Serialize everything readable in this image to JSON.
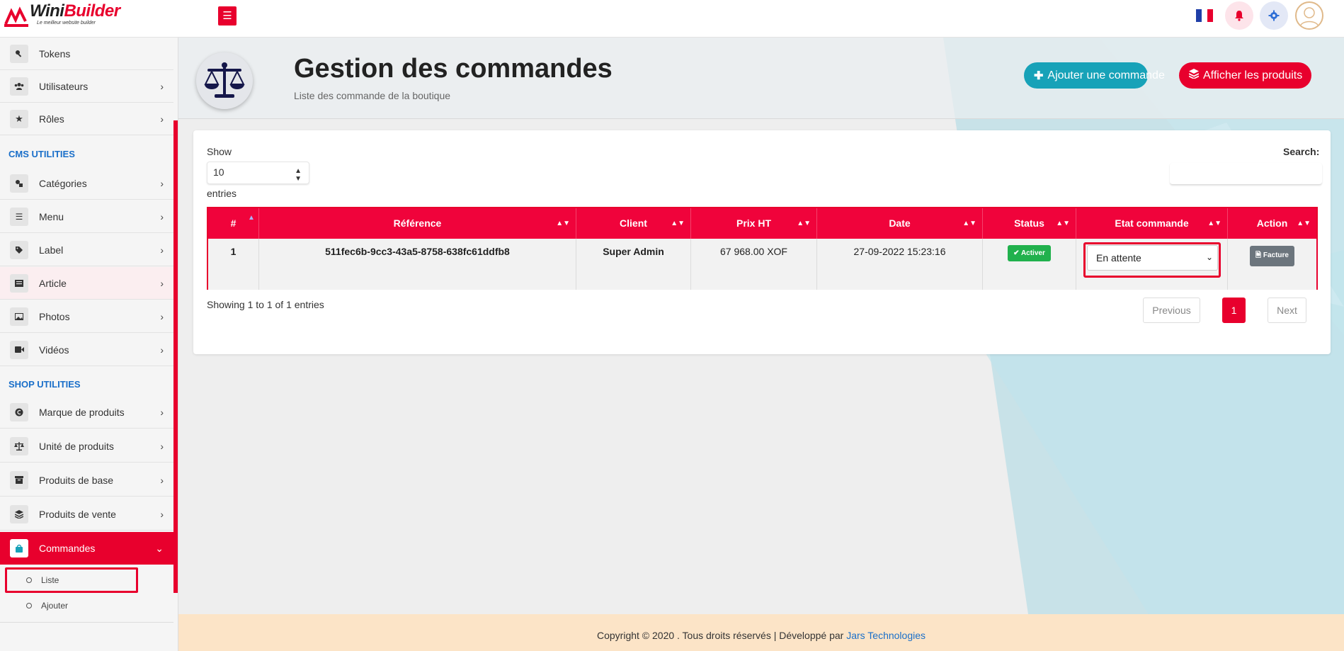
{
  "brand": {
    "name_part1": "Wini",
    "name_part2": "Builder",
    "tagline": "Le meilleur website builder"
  },
  "topbar": {
    "menu_toggle_icon": "hamburger-icon",
    "flag": "fr-flag",
    "notification_icon": "bell-icon",
    "settings_icon": "gear-icon",
    "avatar_icon": "user-avatar-icon"
  },
  "sidebar": {
    "items": [
      {
        "label": "Tokens",
        "icon": "key-icon"
      },
      {
        "label": "Utilisateurs",
        "icon": "users-icon"
      },
      {
        "label": "Rôles",
        "icon": "star-icon"
      }
    ],
    "cms_title": "CMS UTILITIES",
    "cms_items": [
      {
        "label": "Catégories",
        "icon": "shapes-icon"
      },
      {
        "label": "Menu",
        "icon": "list-icon"
      },
      {
        "label": "Label",
        "icon": "tags-icon"
      },
      {
        "label": "Article",
        "icon": "newspaper-icon"
      },
      {
        "label": "Photos",
        "icon": "image-icon"
      },
      {
        "label": "Vidéos",
        "icon": "video-icon"
      }
    ],
    "shop_title": "SHOP UTILITIES",
    "shop_items": [
      {
        "label": "Marque de produits",
        "icon": "copyright-icon"
      },
      {
        "label": "Unité de produits",
        "icon": "balance-icon"
      },
      {
        "label": "Produits de base",
        "icon": "archive-icon"
      },
      {
        "label": "Produits de vente",
        "icon": "layers-icon"
      },
      {
        "label": "Commandes",
        "icon": "shopping-bag-icon"
      }
    ],
    "sub_items": [
      {
        "label": "Liste"
      },
      {
        "label": "Ajouter"
      }
    ]
  },
  "header": {
    "title": "Gestion des commandes",
    "subtitle": "Liste des commande de la boutique",
    "add_button": "Ajouter une commande",
    "products_button": "Afficher les produits"
  },
  "table_controls": {
    "show_label": "Show",
    "length_value": "10",
    "entries_label": "entries",
    "search_label": "Search:"
  },
  "table": {
    "columns": [
      "#",
      "Référence",
      "Client",
      "Prix HT",
      "Date",
      "Status",
      "Etat commande",
      "Action"
    ],
    "rows": [
      {
        "num": "1",
        "reference": "511fec6b-9cc3-43a5-8758-638fc61ddfb8",
        "client": "Super Admin",
        "prix": "67 968.00 XOF",
        "date": "27-09-2022 15:23:16",
        "status": "Activer",
        "etat": "En attente",
        "action": "Facture"
      }
    ]
  },
  "pagination": {
    "info": "Showing 1 to 1 of 1 entries",
    "previous": "Previous",
    "current": "1",
    "next": "Next"
  },
  "footer": {
    "text": "Copyright © 2020 . Tous droits réservés | Développé par ",
    "link": "Jars Technologies"
  },
  "colors": {
    "primary": "#e8002d",
    "teal": "#17a2b8",
    "success": "#21b14d",
    "link": "#1a6fc9"
  }
}
